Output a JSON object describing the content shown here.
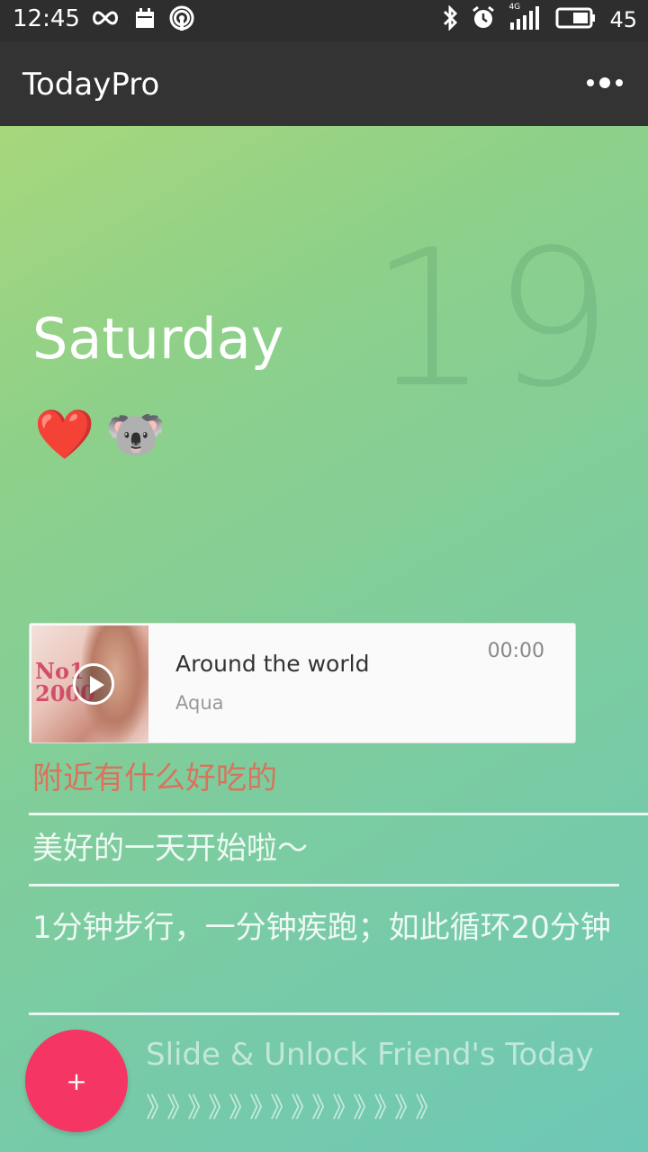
{
  "status_bar": {
    "time": "12:45",
    "battery_level": "45",
    "left_icons": [
      "infinity-icon",
      "calendar-icon",
      "hotspot-icon"
    ],
    "right_icons": [
      "bluetooth-icon",
      "alarm-icon",
      "signal-4g-icon",
      "battery-icon"
    ],
    "network_label": "4G"
  },
  "app_bar": {
    "title": "TodayPro",
    "more_icon": "more-dots-icon"
  },
  "day": {
    "date": "19",
    "weekday": "Saturday",
    "emojis": [
      "❤️",
      "🐨"
    ]
  },
  "music": {
    "title": "Around the world",
    "artist": "Aqua",
    "time": "00:00",
    "album_art_text": "No1 2000",
    "play_icon": "play-icon"
  },
  "items": [
    "附近有什么好吃的",
    "美好的一天开始啦～",
    "1分钟步行，一分钟疾跑；如此循环20分钟"
  ],
  "bottom": {
    "fab_label": "+",
    "unlock_text": "Slide & Unlock Friend's Today",
    "chevrons": "》》》》》》》》》》》》》》"
  },
  "colors": {
    "status_bar": "#2e2e2e",
    "app_bar": "#333333",
    "gradient_start": "#a7d77c",
    "gradient_end": "#6ec8b6",
    "fab": "#f53563",
    "first_item": "#d9735c"
  }
}
